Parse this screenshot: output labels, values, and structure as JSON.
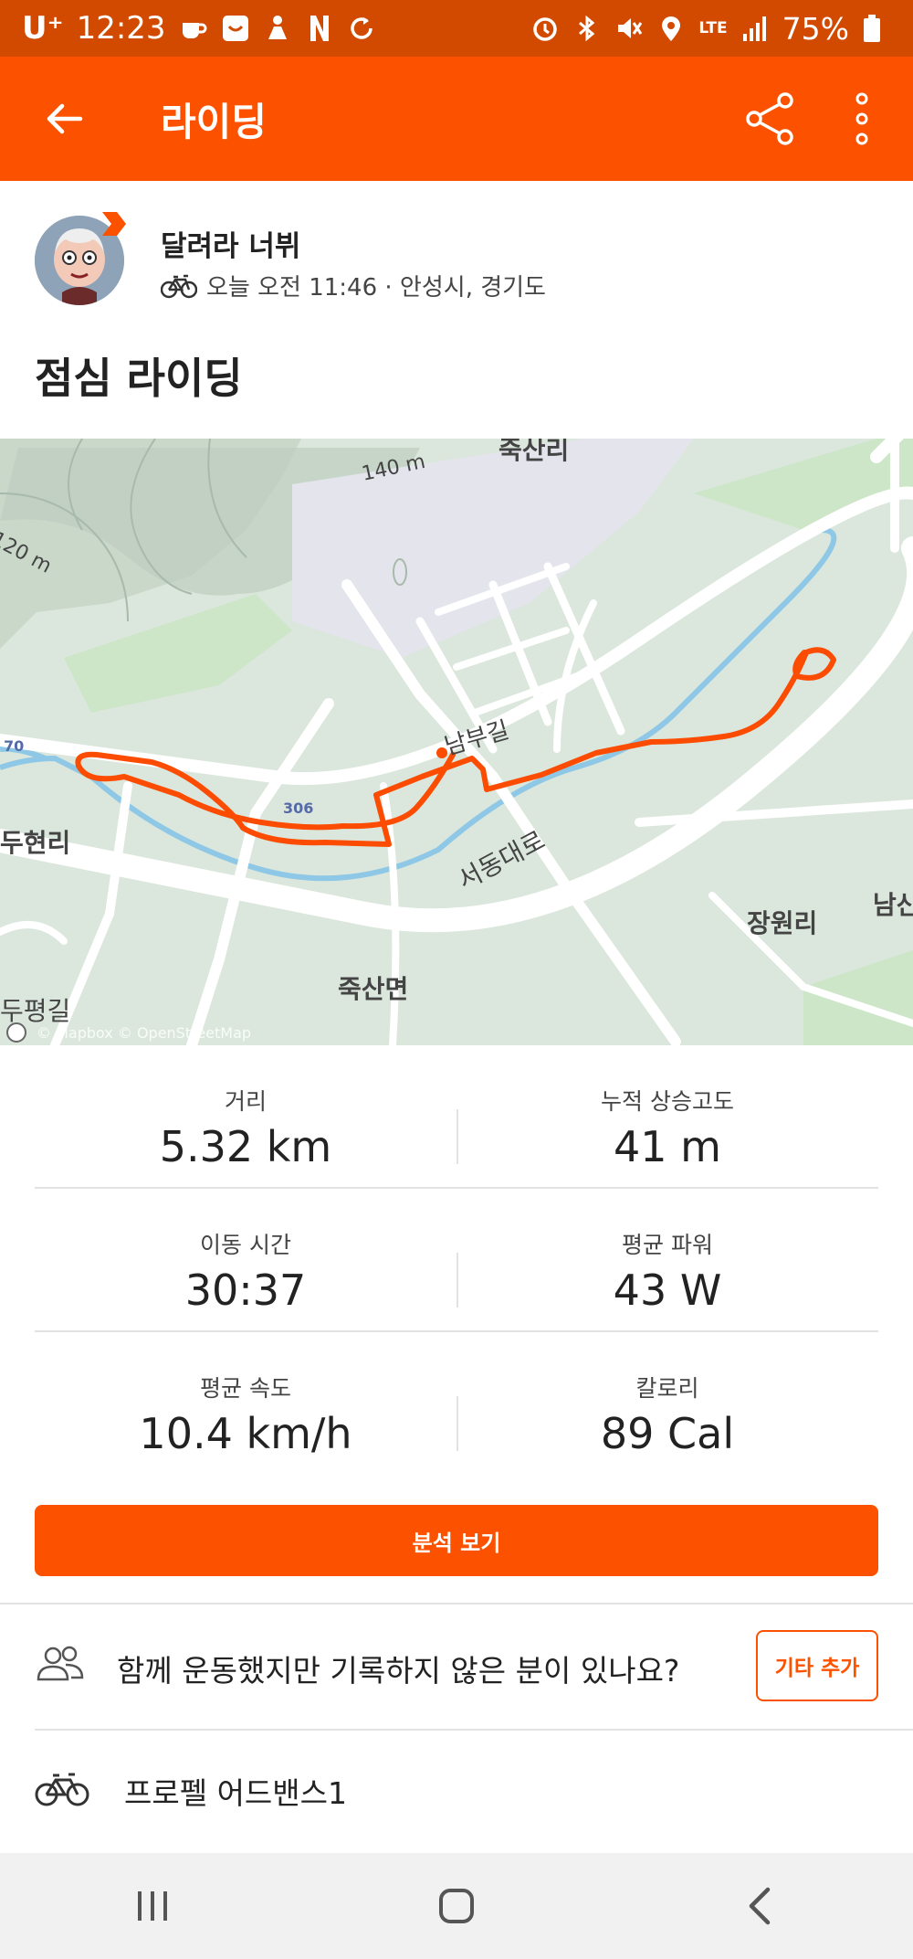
{
  "status_bar": {
    "carrier": "U⁺",
    "time": "12:23",
    "network": "LTE",
    "battery": "75%"
  },
  "app_bar": {
    "title": "라이딩",
    "back_icon": "arrow-left-icon",
    "share_icon": "share-icon",
    "more_icon": "more-vert-icon"
  },
  "athlete": {
    "name": "달려라 너뷔",
    "activity_icon": "bike-icon",
    "meta": "오늘 오전 11:46 · 안성시, 경기도"
  },
  "activity": {
    "title": "점심 라이딩"
  },
  "map": {
    "labels": [
      "죽산리",
      "140 m",
      "120 m",
      "70",
      "두현리",
      "306",
      "남부길",
      "서동대로",
      "장원리",
      "남산",
      "죽산면",
      "두평길",
      "© Mapbox © OpenStreetMap"
    ],
    "route_color": "#fc4c02"
  },
  "stats": [
    {
      "label": "거리",
      "value": "5.32 km"
    },
    {
      "label": "누적 상승고도",
      "value": "41 m"
    },
    {
      "label": "이동 시간",
      "value": "30:37"
    },
    {
      "label": "평균 파워",
      "value": "43 W"
    },
    {
      "label": "평균 속도",
      "value": "10.4 km/h"
    },
    {
      "label": "칼로리",
      "value": "89 Cal"
    }
  ],
  "analyze_button": "분석 보기",
  "together": {
    "icon": "people-icon",
    "text": "함께 운동했지만 기록하지 않은 분이 있나요?",
    "add_button": "기타 추가"
  },
  "gear": {
    "icon": "bike-icon",
    "name": "프로펠 어드밴스1"
  },
  "nav_bar": {
    "recents_icon": "recents-icon",
    "home_icon": "home-icon",
    "back_icon": "nav-back-icon"
  },
  "colors": {
    "brand": "#fc5200",
    "status_bar": "#d24a00"
  }
}
